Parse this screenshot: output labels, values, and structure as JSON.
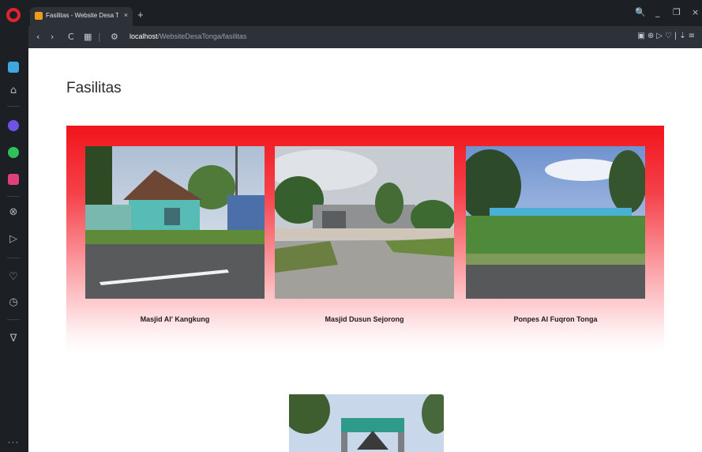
{
  "browser": {
    "tab_title": "Fasilitas - Website Desa To...",
    "tab_close": "×",
    "new_tab": "+",
    "url_host": "localhost",
    "url_path": "/WebsiteDesaTonga/fasilitas",
    "window_controls": [
      "🔍",
      "_",
      "❐",
      "×"
    ],
    "nav_buttons": [
      "‹",
      "›",
      "C",
      "▦",
      "|",
      "⚙"
    ],
    "right_icons": "▣⊕▷♡|⇣≡"
  },
  "sidebar": {
    "icons": [
      "opera-logo",
      "speed-dial-icon",
      "home-icon",
      "messenger-icon",
      "whatsapp-icon",
      "instagram-icon",
      "vk-icon",
      "send-icon",
      "heart-icon",
      "history-icon",
      "flow-icon",
      "more-icon"
    ],
    "more": "···"
  },
  "page": {
    "title": "Fasilitas",
    "facilities": [
      {
        "caption": "Masjid Al' Kangkung"
      },
      {
        "caption": "Masjid Dusun Sejorong"
      },
      {
        "caption": "Ponpes Al Fuqron Tonga"
      }
    ]
  }
}
